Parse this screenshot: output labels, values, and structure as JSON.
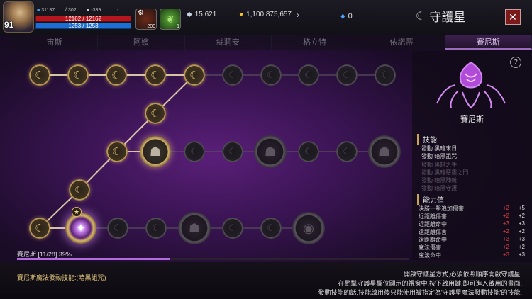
{
  "header": {
    "level": "91",
    "stats": {
      "attack": "31137",
      "defense": "302",
      "power": "-339",
      "extra": "-"
    },
    "hp_text": "12162 / 12162",
    "mp_text": "1253 / 1253",
    "item1_count": "200",
    "item2_count": "1",
    "silver": "15,621",
    "gold": "1,100,875,657",
    "crystal": "0",
    "title": "守護星",
    "close_label": "✕"
  },
  "tabs": [
    "宙斯",
    "阿嬪",
    "絲莉安",
    "格立特",
    "依諾蒂",
    "賽尼斯"
  ],
  "active_tab": 5,
  "board": {
    "progress_label": "賽尼斯 [11/28] 39%",
    "progress_fraction": 0.39,
    "moon_glyph": "☾",
    "sel_glyph": "✦",
    "star_glyph": "★"
  },
  "panel": {
    "help": "?",
    "name": "賽尼斯",
    "skills_title": "技能",
    "skills": [
      {
        "text": "發動 黑暗末日",
        "active": true
      },
      {
        "text": "發動 暗黑詛咒",
        "active": true
      },
      {
        "text": "發動 黑暗之手",
        "active": false
      },
      {
        "text": "發動 黑暗惡靈之門",
        "active": false
      },
      {
        "text": "發動 暗黑陣雜",
        "active": false
      },
      {
        "text": "發動 暗黑守護",
        "active": false
      }
    ],
    "attrs_title": "能力值",
    "attrs": [
      {
        "name": "決勝一擊追加傷害",
        "cur": "+2",
        "next": "+5"
      },
      {
        "name": "近距離傷害",
        "cur": "+2",
        "next": "+2"
      },
      {
        "name": "近距離命中",
        "cur": "+3",
        "next": "+3"
      },
      {
        "name": "遠距離傷害",
        "cur": "+2",
        "next": "+2"
      },
      {
        "name": "遠距離命中",
        "cur": "+3",
        "next": "+3"
      },
      {
        "name": "魔法傷害",
        "cur": "+2",
        "next": "+2"
      },
      {
        "name": "魔法命中",
        "cur": "+3",
        "next": "+3"
      }
    ]
  },
  "footer": {
    "left": "賽尼斯魔法發動技能:(暗黑詛咒)",
    "lines": [
      "開啟守護星方式,必須依照順序開啟守護星.",
      "在點擊守護星欄位顯示的視窗中,按下啟用鍵,即可進入啟用的畫面.",
      "發動技能的話,技能啟用後只能使用被指定為'守護星魔法發動技能'的技能."
    ]
  },
  "colors": {
    "accent": "#b46be0",
    "gold": "#d6b46a",
    "plus_red": "#e04040"
  }
}
